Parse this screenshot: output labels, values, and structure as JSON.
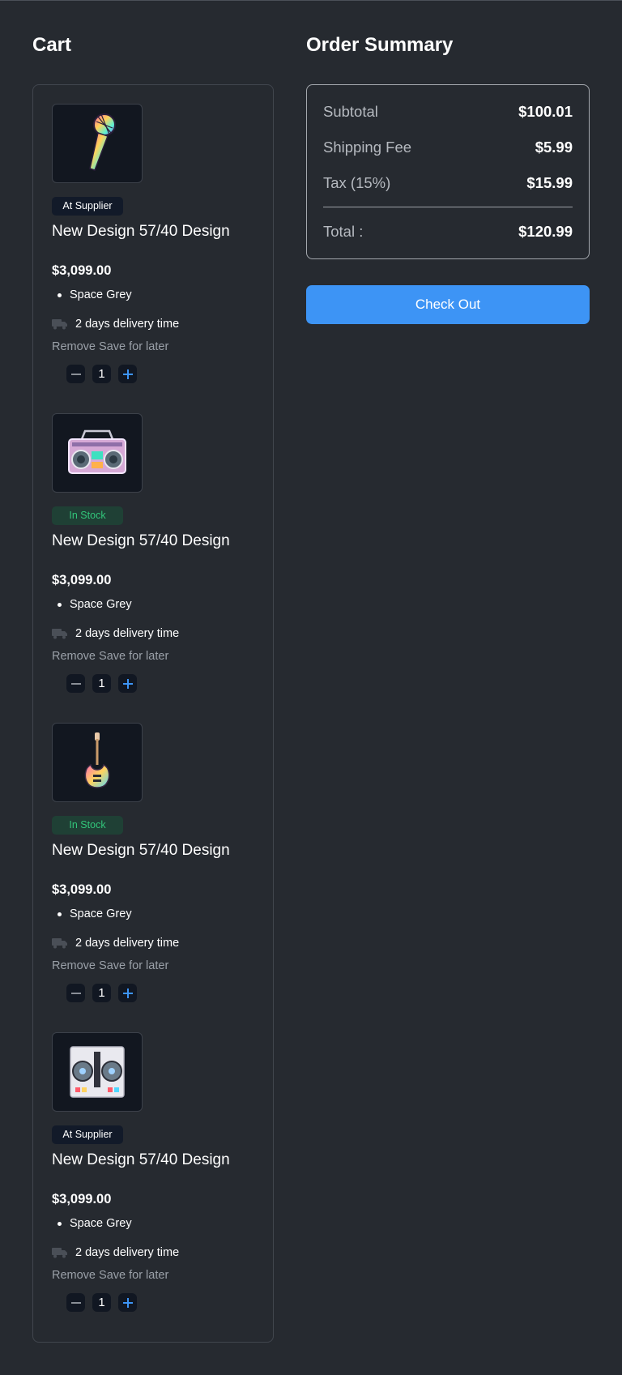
{
  "cart": {
    "title": "Cart",
    "items": [
      {
        "image": "microphone",
        "badge": "At Supplier",
        "badge_type": "supplier",
        "name": "New Design 57/40 Design",
        "price": "$3,099.00",
        "color": "Space Grey",
        "delivery": "2 days delivery time",
        "remove": "Remove",
        "save": "Save for later",
        "qty": "1"
      },
      {
        "image": "boombox",
        "badge": "In Stock",
        "badge_type": "stock",
        "name": "New Design 57/40 Design",
        "price": "$3,099.00",
        "color": "Space Grey",
        "delivery": "2 days delivery time",
        "remove": "Remove",
        "save": "Save for later",
        "qty": "1"
      },
      {
        "image": "electric-guitar",
        "badge": "In Stock",
        "badge_type": "stock",
        "name": "New Design 57/40 Design",
        "price": "$3,099.00",
        "color": "Space Grey",
        "delivery": "2 days delivery time",
        "remove": "Remove",
        "save": "Save for later",
        "qty": "1"
      },
      {
        "image": "dj-controller",
        "badge": "At Supplier",
        "badge_type": "supplier",
        "name": "New Design 57/40 Design",
        "price": "$3,099.00",
        "color": "Space Grey",
        "delivery": "2 days delivery time",
        "remove": "Remove",
        "save": "Save for later",
        "qty": "1"
      }
    ]
  },
  "summary": {
    "title": "Order Summary",
    "subtotal_label": "Subtotal",
    "subtotal_value": "$100.01",
    "shipping_label": "Shipping Fee",
    "shipping_value": "$5.99",
    "tax_label": "Tax (15%)",
    "tax_value": "$15.99",
    "total_label": "Total :",
    "total_value": "$120.99",
    "checkout_label": "Check Out"
  },
  "colors": {
    "accent": "#3d94f5",
    "in_stock_text": "#32c57a",
    "background": "#262a30"
  },
  "icons": {
    "truck": "truck-icon",
    "minus": "minus-icon",
    "plus": "plus-icon"
  }
}
